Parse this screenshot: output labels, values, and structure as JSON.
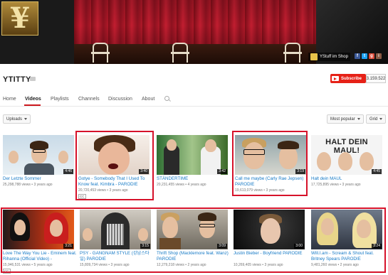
{
  "channel": {
    "avatar_glyph": "¥",
    "name": "YTITTY",
    "shop_label": "YStuff im Shop",
    "subscribe_label": "Subscribe",
    "subscriber_count": "3.159.522",
    "social_icons": [
      "facebook-icon",
      "twitter-icon",
      "google-plus-icon",
      "instagram-icon"
    ]
  },
  "tabs": [
    {
      "label": "Home",
      "active": false
    },
    {
      "label": "Videos",
      "active": true
    },
    {
      "label": "Playlists",
      "active": false
    },
    {
      "label": "Channels",
      "active": false
    },
    {
      "label": "Discussion",
      "active": false
    },
    {
      "label": "About",
      "active": false
    }
  ],
  "controls": {
    "uploads_label": "Uploads",
    "sort_label": "Most popular",
    "view_label": "Grid"
  },
  "videos": [
    {
      "title": "Der Letzte Sommer",
      "views": "25,298,788 views",
      "age": "3 years ago",
      "duration": "4:46",
      "cc": false
    },
    {
      "title": "Gotye - Somebody That I Used To Know feat. Kimbra - PARODIE",
      "views": "20,720,453 views",
      "age": "3 years ago",
      "duration": "3:40",
      "cc": true,
      "cc_label": "CC"
    },
    {
      "title": "STÄNDERTIME",
      "views": "20,231,455 views",
      "age": "4 years ago",
      "duration": "3:42",
      "cc": false
    },
    {
      "title": "Call me maybe (Carly Rae Jepsen) PARODIE",
      "views": "19,613,079 views",
      "age": "3 years ago",
      "duration": "3:19",
      "cc": false
    },
    {
      "title": "Halt dein MAUL",
      "views": "17,725,895 views",
      "age": "3 years ago",
      "duration": "4:45",
      "cc": false,
      "thumb_text": "HALT DEIN MAUL!"
    },
    {
      "title": "Love The Way You Lie - Eminem feat. Rihanna (Official Video) -",
      "views": "15,946,531 views",
      "age": "5 years ago",
      "duration": "3:21",
      "cc": true,
      "cc_label": "CC"
    },
    {
      "title": "PSY - GANGNAM STYLE (강남스타일) PARODIE",
      "views": "15,809,734 views",
      "age": "3 years ago",
      "duration": "3:15",
      "cc": false
    },
    {
      "title": "Thrift Shop (Macklemore feat. Wanz) PARODIE",
      "views": "12,279,218 views",
      "age": "2 years ago",
      "duration": "3:09",
      "cc": false
    },
    {
      "title": "Justin Bieber - Boyfriend PARODIE",
      "views": "10,269,405 views",
      "age": "3 years ago",
      "duration": "3:00",
      "cc": false
    },
    {
      "title": "Will.I.am - Scream & Shout feat. Britney Spears PARODIE",
      "views": "9,481,260 views",
      "age": "2 years ago",
      "duration": "3:24",
      "cc": false
    }
  ]
}
